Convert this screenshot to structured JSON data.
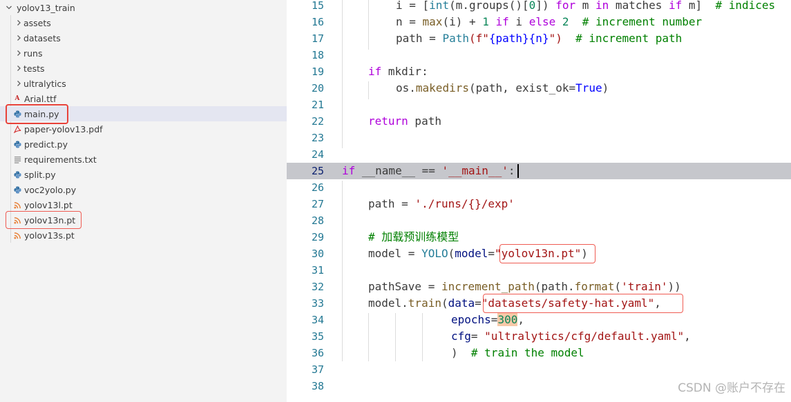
{
  "explorer": {
    "root": "yolov13_train",
    "items": [
      {
        "label": "assets",
        "kind": "folder"
      },
      {
        "label": "datasets",
        "kind": "folder"
      },
      {
        "label": "runs",
        "kind": "folder"
      },
      {
        "label": "tests",
        "kind": "folder"
      },
      {
        "label": "ultralytics",
        "kind": "folder"
      },
      {
        "label": "Arial.ttf",
        "kind": "font",
        "icon_text": "A"
      },
      {
        "label": "main.py",
        "kind": "python",
        "selected": true
      },
      {
        "label": "paper-yolov13.pdf",
        "kind": "pdf"
      },
      {
        "label": "predict.py",
        "kind": "python"
      },
      {
        "label": "requirements.txt",
        "kind": "text"
      },
      {
        "label": "split.py",
        "kind": "python"
      },
      {
        "label": "voc2yolo.py",
        "kind": "python"
      },
      {
        "label": "yolov13l.pt",
        "kind": "rss"
      },
      {
        "label": "yolov13n.pt",
        "kind": "rss"
      },
      {
        "label": "yolov13s.pt",
        "kind": "rss"
      }
    ]
  },
  "editor": {
    "line_numbers": [
      "15",
      "16",
      "17",
      "18",
      "19",
      "20",
      "21",
      "22",
      "23",
      "24",
      "25",
      "26",
      "27",
      "28",
      "29",
      "30",
      "31",
      "32",
      "33",
      "34",
      "35",
      "36",
      "37",
      "38"
    ],
    "current_line": "25",
    "code": {
      "l15": {
        "a": "i = [",
        "b": "int",
        "c": "(m.groups()[",
        "d": "0",
        "e": "]) ",
        "f": "for",
        "g": " m ",
        "h": "in",
        "i": " matches ",
        "j": "if",
        "k": " m]  ",
        "l": "# indices"
      },
      "l16": {
        "a": "n = ",
        "b": "max",
        "c": "(i) + ",
        "d": "1",
        "e": " ",
        "f": "if",
        "g": " i ",
        "h": "else",
        "i": " ",
        "j": "2",
        "k": "  ",
        "l": "# increment number"
      },
      "l17": {
        "a": "path = ",
        "b": "Path",
        "c": "(f\"",
        "d": "{path}{n}",
        "e": "\")  ",
        "f": "# increment path"
      },
      "l19": {
        "a": "if",
        "b": " mkdir:"
      },
      "l20": {
        "a": "os.",
        "b": "makedirs",
        "c": "(path, exist_ok=",
        "d": "True",
        "e": ")"
      },
      "l22": {
        "a": "return",
        "b": " path"
      },
      "l25": {
        "a": "if",
        "b": " __name__ == ",
        "c": "'__main__'",
        "d": ":"
      },
      "l27": {
        "a": "path = ",
        "b": "'./runs/{}/exp'"
      },
      "l29": {
        "a": "# 加载预训练模型"
      },
      "l30": {
        "a": "model = ",
        "b": "YOLO",
        "c": "(",
        "d": "model",
        "e": "=",
        "f": "\"yolov13n.pt\"",
        "g": ")"
      },
      "l32": {
        "a": "pathSave = ",
        "b": "increment_path",
        "c": "(path.",
        "d": "format",
        "e": "(",
        "f": "'train'",
        "g": "))"
      },
      "l33": {
        "a": "model.",
        "b": "train",
        "c": "(",
        "d": "data",
        "e": "=",
        "f": "\"datasets/safety-hat.yaml\"",
        "g": ","
      },
      "l34": {
        "a": "epochs",
        "b": "=",
        "c": "300",
        "d": ","
      },
      "l35": {
        "a": "cfg",
        "b": "= ",
        "c": "\"ultralytics/cfg/default.yaml\"",
        "d": ","
      },
      "l36": {
        "a": ")  ",
        "b": "# train the model"
      }
    }
  },
  "watermark": "CSDN @账户不存在",
  "colors": {
    "keyword": "#0000ff",
    "control": "#af00db",
    "string": "#a31515",
    "comment": "#008000",
    "function": "#795e26",
    "class": "#267f99",
    "number": "#098658",
    "highlight_box": "#e8423a"
  }
}
